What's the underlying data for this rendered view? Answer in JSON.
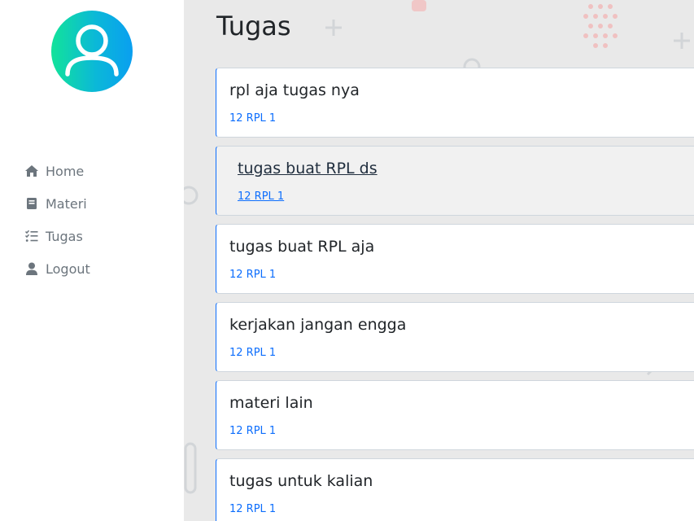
{
  "sidebar": {
    "items": [
      {
        "label": "Home",
        "icon": "home-icon"
      },
      {
        "label": "Materi",
        "icon": "book-icon"
      },
      {
        "label": "Tugas",
        "icon": "list-check-icon"
      },
      {
        "label": "Logout",
        "icon": "user-icon"
      }
    ]
  },
  "main": {
    "title": "Tugas",
    "cards": [
      {
        "title": "rpl aja tugas nya",
        "class": "12 RPL 1"
      },
      {
        "title": "tugas buat RPL ds",
        "class": "12 RPL 1"
      },
      {
        "title": "tugas buat RPL aja",
        "class": "12 RPL 1"
      },
      {
        "title": "kerjakan jangan engga",
        "class": "12 RPL 1"
      },
      {
        "title": "materi lain",
        "class": "12 RPL 1"
      },
      {
        "title": "tugas untuk kalian",
        "class": "12 RPL 1"
      }
    ]
  },
  "colors": {
    "accent": "#0d6efd",
    "sidebar_text": "#6c757d",
    "avatar_gradient_start": "#12e39a",
    "avatar_gradient_end": "#0a9ff0"
  }
}
